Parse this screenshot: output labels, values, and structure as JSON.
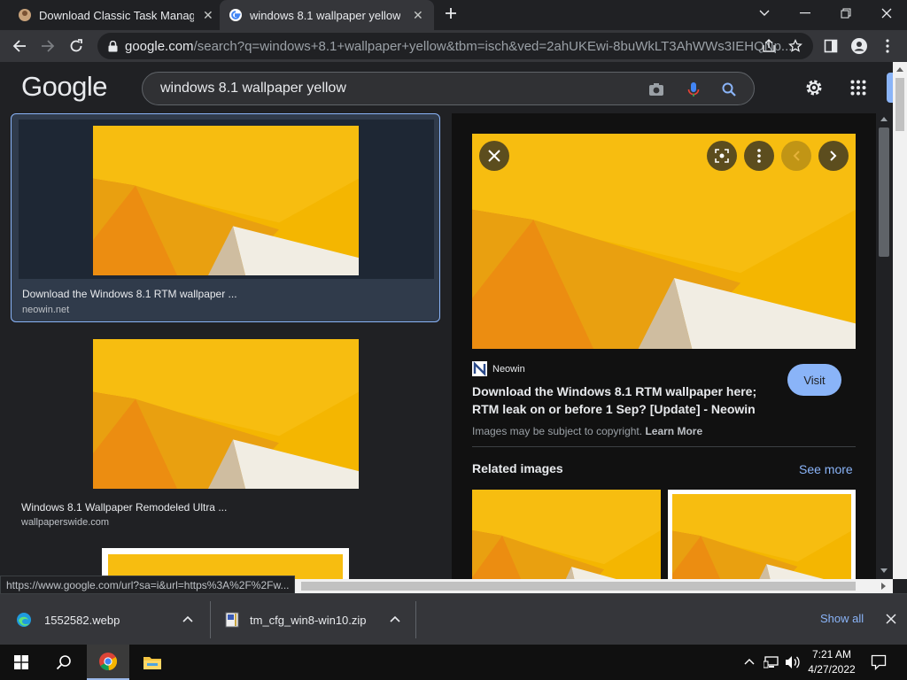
{
  "tabs": [
    {
      "title": "Download Classic Task Manager f",
      "active": false
    },
    {
      "title": "windows 8.1 wallpaper yellow - G",
      "active": true
    }
  ],
  "omnibox": {
    "host": "google.com",
    "path": "/search?q=windows+8.1+wallpaper+yellow&tbm=isch&ved=2ahUKEwi-8buWkLT3AhWWs3IEHQNp..."
  },
  "google": {
    "logo": "Google",
    "query": "windows 8.1 wallpaper yellow"
  },
  "results": [
    {
      "title": "Download the Windows 8.1 RTM wallpaper ...",
      "source": "neowin.net",
      "selected": true
    },
    {
      "title": "Windows 8.1 Wallpaper Remodeled Ultra ...",
      "source": "wallpaperswide.com",
      "selected": false
    }
  ],
  "preview": {
    "source_name": "Neowin",
    "title": "Download the Windows 8.1 RTM wallpaper here; RTM leak on or before 1 Sep? [Update] - Neowin",
    "visit_label": "Visit",
    "copyright": "Images may be subject to copyright.",
    "learn_more": "Learn More",
    "related_heading": "Related images",
    "see_more": "See more"
  },
  "status_url": "https://www.google.com/url?sa=i&url=https%3A%2F%2Fw...",
  "downloads": [
    {
      "name": "1552582.webp"
    },
    {
      "name": "tm_cfg_win8-win10.zip"
    }
  ],
  "downloads_show_all": "Show all",
  "clock": {
    "time": "7:21 AM",
    "date": "4/27/2022"
  },
  "colors": {
    "accent": "#8ab4f8",
    "wallpaper": "#f5b800",
    "background": "#202124"
  }
}
